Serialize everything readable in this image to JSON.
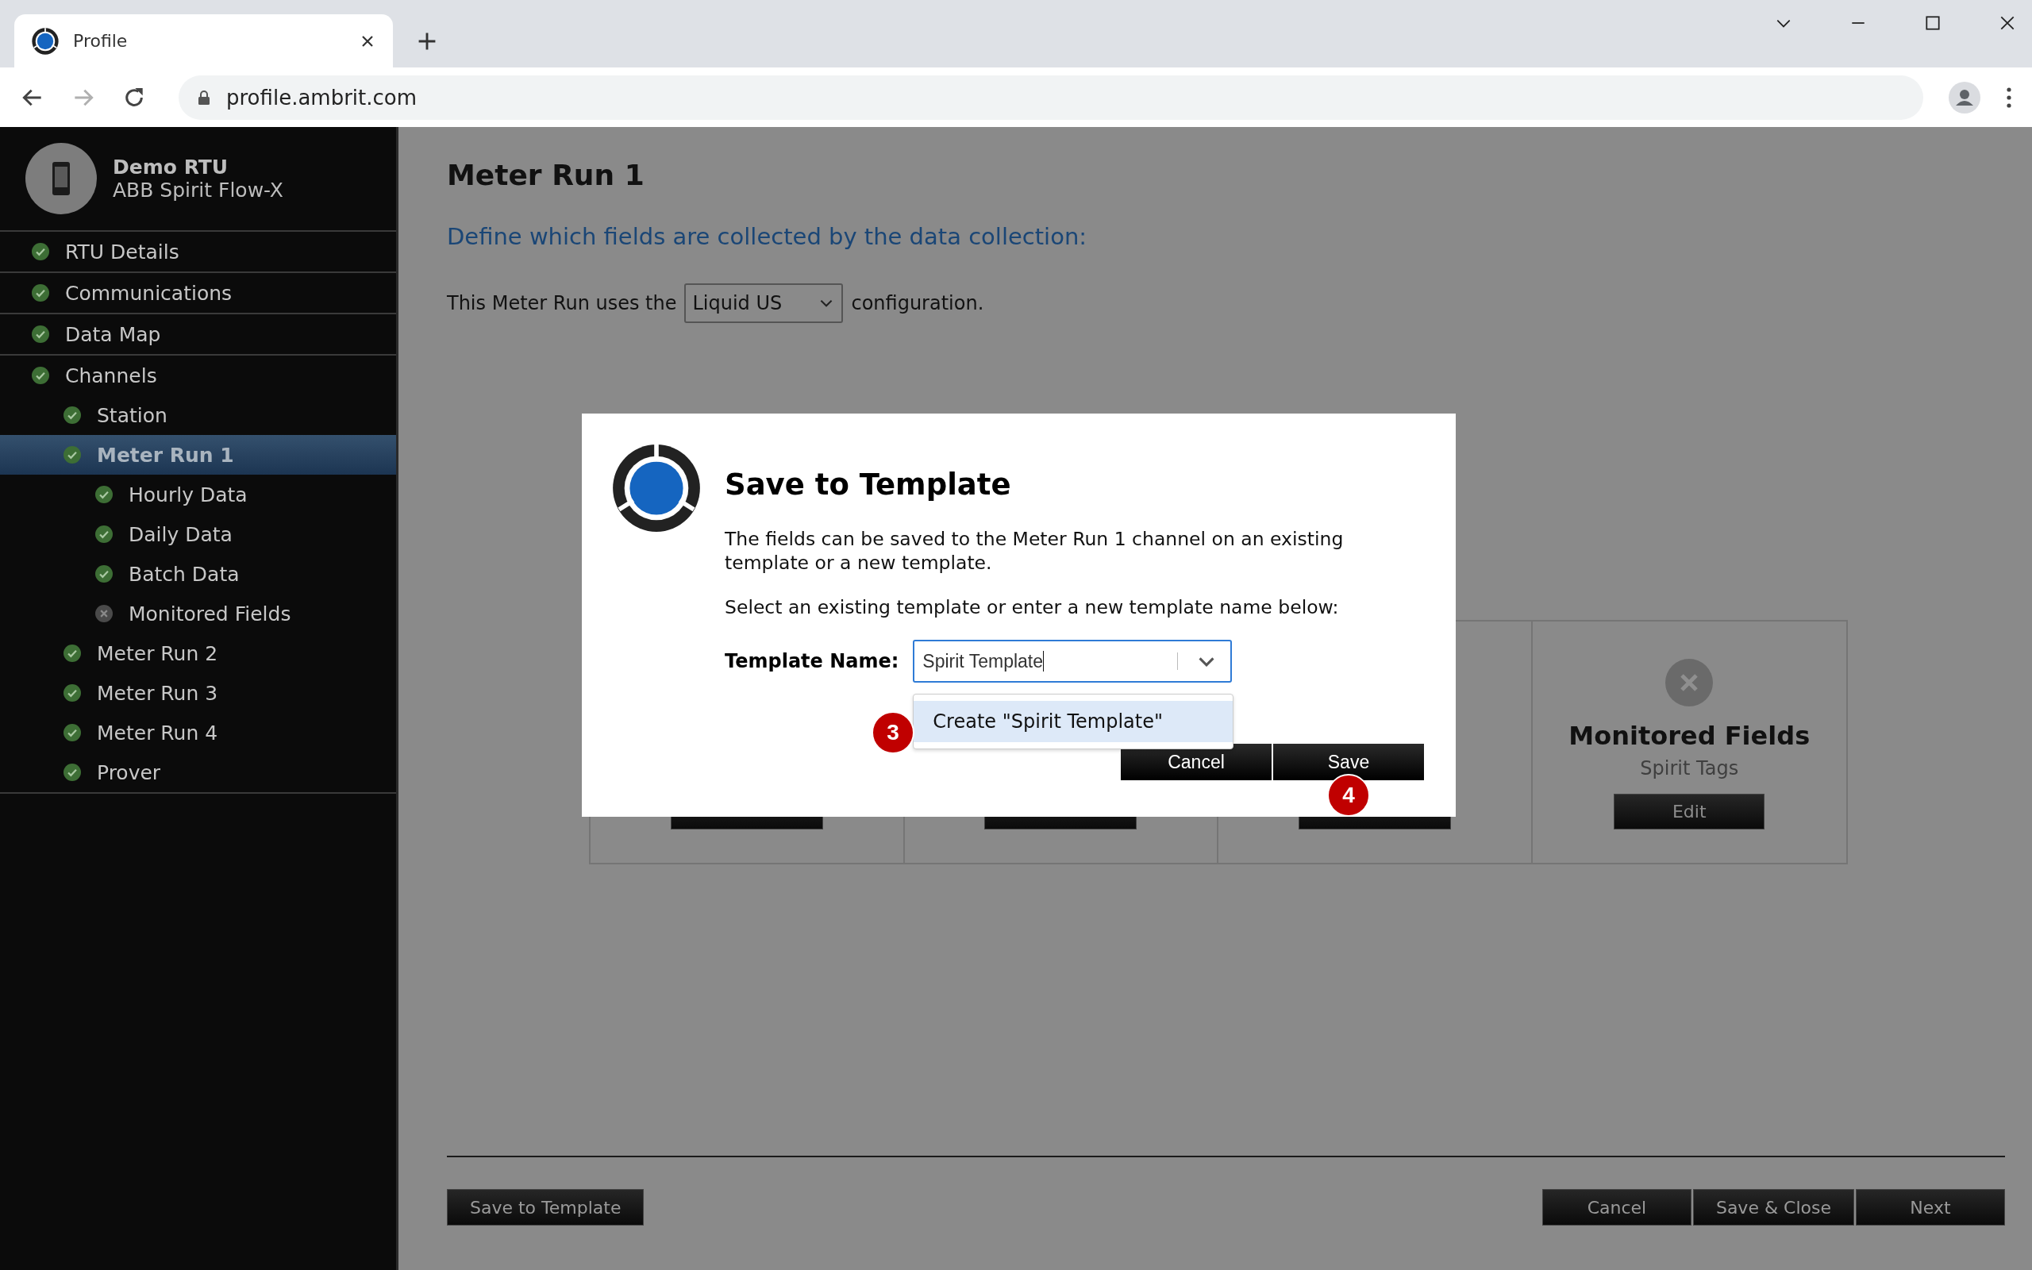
{
  "browser": {
    "tab_title": "Profile",
    "url": "profile.ambrit.com"
  },
  "sidebar": {
    "device_name": "Demo RTU",
    "device_model": "ABB Spirit Flow-X",
    "items": [
      {
        "label": "RTU Details",
        "complete": true,
        "selected": false
      },
      {
        "label": "Communications",
        "complete": true,
        "selected": false
      },
      {
        "label": "Data Map",
        "complete": true,
        "selected": false
      },
      {
        "label": "Channels",
        "complete": true,
        "selected": false,
        "children": [
          {
            "label": "Station",
            "complete": true,
            "selected": false
          },
          {
            "label": "Meter Run 1",
            "complete": true,
            "selected": true,
            "children": [
              {
                "label": "Hourly Data",
                "complete": true,
                "selected": false
              },
              {
                "label": "Daily Data",
                "complete": true,
                "selected": false
              },
              {
                "label": "Batch Data",
                "complete": true,
                "selected": false
              },
              {
                "label": "Monitored Fields",
                "complete": false,
                "selected": false
              }
            ]
          },
          {
            "label": "Meter Run 2",
            "complete": true,
            "selected": false
          },
          {
            "label": "Meter Run 3",
            "complete": true,
            "selected": false
          },
          {
            "label": "Meter Run 4",
            "complete": true,
            "selected": false
          },
          {
            "label": "Prover",
            "complete": true,
            "selected": false
          }
        ]
      }
    ]
  },
  "page": {
    "title": "Meter Run 1",
    "subtitle": "Define which fields are collected by the data collection:",
    "config_prefix": "This Meter Run uses the",
    "config_value": "Liquid US",
    "config_suffix": "configuration."
  },
  "cards": [
    {
      "kind": "covered"
    },
    {
      "kind": "covered"
    },
    {
      "kind": "covered"
    },
    {
      "kind": "field_group",
      "complete": false,
      "title": "Monitored Fields",
      "subtitle": "Spirit Tags",
      "button": "Edit"
    }
  ],
  "footer": {
    "left_button": "Save to Template",
    "right_buttons": [
      "Cancel",
      "Save & Close",
      "Next"
    ]
  },
  "dialog": {
    "title": "Save to Template",
    "paragraphs": [
      "The fields can be saved to the Meter Run 1 channel on an existing template or a new template.",
      "Select an existing template or enter a new template name below:"
    ],
    "field_label": "Template Name:",
    "field_value": "Spirit Template",
    "suggestion": "Create \"Spirit Template\"",
    "buttons": [
      "Cancel",
      "Save"
    ],
    "callouts": [
      "3",
      "4"
    ]
  }
}
